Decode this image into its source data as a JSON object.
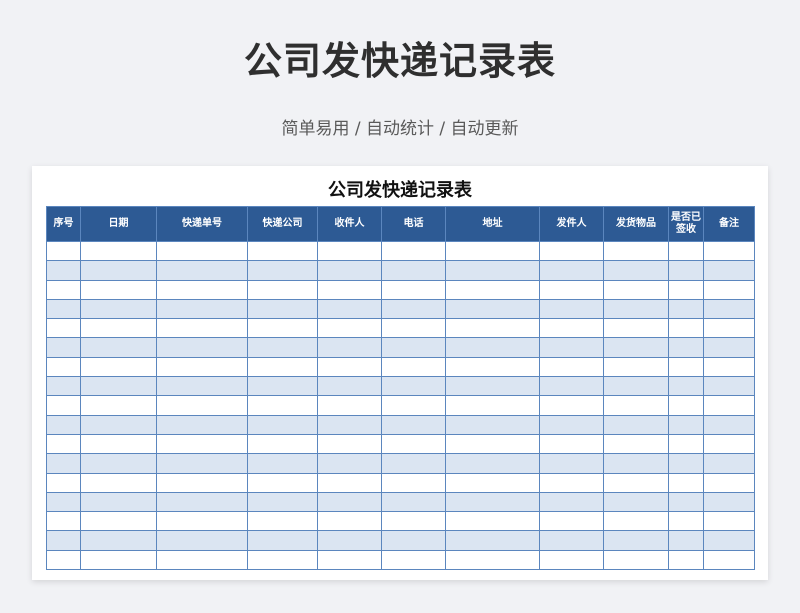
{
  "header": {
    "title": "公司发快递记录表",
    "subtitle": "简单易用 / 自动统计 / 自动更新"
  },
  "sheet": {
    "title": "公司发快递记录表",
    "columns": [
      "序号",
      "日期",
      "快递单号",
      "快递公司",
      "收件人",
      "电话",
      "地址",
      "发件人",
      "发货物品",
      "是否已签收",
      "备注"
    ],
    "empty_rows": 17
  },
  "colors": {
    "header_bg": "#2d5a94",
    "alt_row_bg": "#dbe5f2",
    "grid_line": "#5b86be"
  }
}
